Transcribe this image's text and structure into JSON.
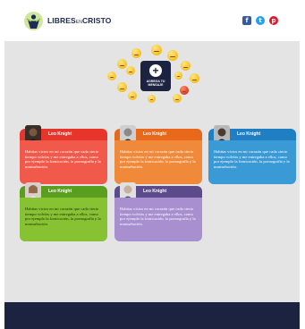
{
  "header": {
    "logo_main": "LIBRES",
    "logo_small": "EN",
    "logo_end": "CRISTO",
    "social": [
      {
        "icon": "facebook-icon",
        "glyph": "f"
      },
      {
        "icon": "twitter-icon",
        "glyph": "t"
      },
      {
        "icon": "pinterest-icon",
        "glyph": "p"
      }
    ]
  },
  "hero": {
    "add_button_label": "AGREGA TU MENSAJE",
    "plus_glyph": "+"
  },
  "cards": [
    {
      "name": "Leo Knight",
      "text": "Habitas vicios en mi corazón que cada cierto tiempo volvías y me entregaba a ellos, como por ejemplo la fornicación, la pornografía y la masturbación.",
      "header_color": "#e8352c",
      "body_color": "#f15a4a",
      "text_color": "#ffffff"
    },
    {
      "name": "Leo Knight",
      "text": "Habitas vicios en mi corazón que cada cierto tiempo volvías y me entregaba a ellos, como por ejemplo la fornicación, la pornografía y la masturbación.",
      "header_color": "#e8691c",
      "body_color": "#f08a3a",
      "text_color": "#ffffff"
    },
    {
      "name": "Leo Knight",
      "text": "Habitas vicios en mi corazón que cada cierto tiempo volvías y me entregaba a ellos, como por ejemplo la fornicación, la pornografía y la masturbación.",
      "header_color": "#1f7fc2",
      "body_color": "#3a9ad6",
      "text_color": "#ffffff"
    },
    {
      "name": "Leo Knight",
      "text": "Habitas vicios en mi corazón que cada cierto tiempo volvías y me entregaba a ellos, como por ejemplo la fornicación, la pornografía y la masturbación.",
      "header_color": "#5a9e1e",
      "body_color": "#86c232",
      "text_color": "#1d2a10"
    },
    {
      "name": "Leo Knight",
      "text": "Habitas vicios en mi corazón que cada cierto tiempo volvías y me entregaba a ellos, como por ejemplo la fornicación, la pornografía y la masturbación.",
      "header_color": "#5c4a8a",
      "body_color": "#a88fcf",
      "text_color": "#ffffff"
    }
  ],
  "colors": {
    "footer": "#1c2340",
    "background": "#e4e4e4"
  }
}
